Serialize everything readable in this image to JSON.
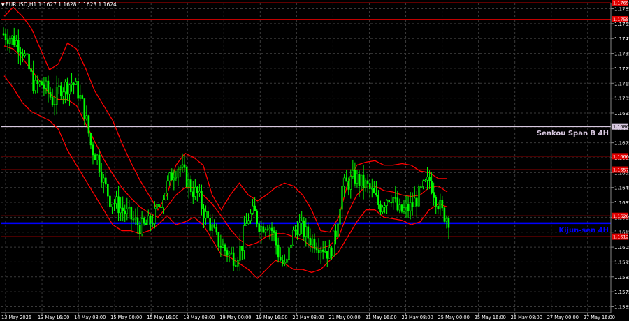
{
  "header": {
    "symbol_info": "EURUSD,H1  1.1627 1.1628 1.1623 1.1624"
  },
  "colors": {
    "background": "#000000",
    "grid": "#3a3a3a",
    "bull": "#00ff00",
    "bear": "#00ff00",
    "bands": "#ff0000",
    "levels": "#c00000",
    "senkou": "#d8c8e0",
    "kijun": "#0000ff",
    "text": "#ffffff"
  },
  "chart_data": {
    "type": "candlestick",
    "title": "",
    "y_ticks": [
      "1.1765",
      "1.1755",
      "1.1745",
      "1.1735",
      "1.1725",
      "1.1715",
      "1.1705",
      "1.1695",
      "1.1685",
      "1.1675",
      "1.1665",
      "1.1655",
      "1.1645",
      "1.1635",
      "1.1625",
      "1.1615",
      "1.1605",
      "1.1595",
      "1.1585",
      "1.1575",
      "1.1565"
    ],
    "ylim": [
      1.1561,
      1.1769
    ],
    "x_ticks": [
      "13 May 2026",
      "13 May 16:00",
      "14 May 08:00",
      "15 May 00:00",
      "15 May 16:00",
      "18 May 08:00",
      "19 May 00:00",
      "19 May 16:00",
      "20 May 08:00",
      "21 May 00:00",
      "21 May 16:00",
      "22 May 08:00",
      "25 May 00:00",
      "25 May 16:00",
      "26 May 08:00",
      "27 May 00:00",
      "27 May 16:00"
    ],
    "horizontal_levels": [
      {
        "value": 1.1769,
        "label": "1.1769",
        "kind": "resistance"
      },
      {
        "value": 1.1758,
        "label": "1.1758",
        "kind": "resistance"
      },
      {
        "value": 1.1666,
        "label": "1.1666",
        "kind": "resistance"
      },
      {
        "value": 1.1657,
        "label": "1.1657",
        "kind": "resistance"
      },
      {
        "value": 1.1686,
        "label": "1.1686",
        "kind": "senkou"
      },
      {
        "value": 1.1626,
        "label": "1.1626",
        "kind": "support"
      },
      {
        "value": 1.1612,
        "label": "1.1612",
        "kind": "support"
      },
      {
        "value": 1.1621,
        "label": "",
        "kind": "kijun"
      }
    ],
    "line_labels": {
      "senkou": "Senkou Span B 4H",
      "kijun": "Kijun-sen 4H"
    },
    "close_path": [
      1.1748,
      1.1746,
      1.1743,
      1.1738,
      1.1725,
      1.1712,
      1.1715,
      1.171,
      1.1702,
      1.1712,
      1.1713,
      1.1716,
      1.1708,
      1.1695,
      1.1672,
      1.1665,
      1.1648,
      1.1637,
      1.1634,
      1.163,
      1.1626,
      1.1622,
      1.1618,
      1.162,
      1.1625,
      1.1635,
      1.1645,
      1.1655,
      1.166,
      1.1652,
      1.1644,
      1.164,
      1.1628,
      1.162,
      1.161,
      1.1605,
      1.16,
      1.1598,
      1.1606,
      1.1625,
      1.1628,
      1.1618,
      1.1622,
      1.1615,
      1.1598,
      1.159,
      1.1612,
      1.162,
      1.1615,
      1.161,
      1.1608,
      1.1605,
      1.16,
      1.1615,
      1.1645,
      1.1648,
      1.1652,
      1.1648,
      1.1646,
      1.164,
      1.1632,
      1.1638,
      1.164,
      1.1628,
      1.163,
      1.1632,
      1.1638,
      1.1645,
      1.165,
      1.1638,
      1.1628,
      1.1624
    ],
    "upper_band": [
      1.176,
      1.1766,
      1.176,
      1.1752,
      1.1738,
      1.1724,
      1.1728,
      1.1742,
      1.1738,
      1.1725,
      1.171,
      1.17,
      1.169,
      1.1675,
      1.1662,
      1.165,
      1.164,
      1.163,
      1.164,
      1.166,
      1.1668,
      1.1665,
      1.166,
      1.164,
      1.163,
      1.164,
      1.1648,
      1.164,
      1.1636,
      1.164,
      1.1645,
      1.1648,
      1.1646,
      1.164,
      1.163,
      1.1616,
      1.1615,
      1.1625,
      1.1648,
      1.166,
      1.1662,
      1.1663,
      1.166,
      1.166,
      1.1661,
      1.166,
      1.1656,
      1.1655,
      1.1651,
      1.1651
    ],
    "middle_band": [
      1.174,
      1.1738,
      1.1732,
      1.1724,
      1.1716,
      1.1708,
      1.1704,
      1.1704,
      1.17,
      1.1688,
      1.1676,
      1.1664,
      1.1654,
      1.1645,
      1.1638,
      1.1632,
      1.1628,
      1.1625,
      1.1632,
      1.164,
      1.1645,
      1.1645,
      1.164,
      1.1634,
      1.1626,
      1.1617,
      1.161,
      1.1606,
      1.1608,
      1.1612,
      1.1614,
      1.1614,
      1.1612,
      1.161,
      1.1605,
      1.1604,
      1.1606,
      1.1612,
      1.1628,
      1.164,
      1.1646,
      1.1646,
      1.1643,
      1.1642,
      1.164,
      1.1639,
      1.164,
      1.1645,
      1.1646,
      1.1642
    ],
    "lower_band": [
      1.172,
      1.1712,
      1.1702,
      1.1696,
      1.1693,
      1.169,
      1.1684,
      1.167,
      1.166,
      1.165,
      1.164,
      1.163,
      1.162,
      1.1616,
      1.1616,
      1.1614,
      1.1616,
      1.162,
      1.1626,
      1.162,
      1.1622,
      1.1625,
      1.162,
      1.161,
      1.16,
      1.1598,
      1.1594,
      1.159,
      1.1584,
      1.159,
      1.1596,
      1.1594,
      1.159,
      1.159,
      1.1588,
      1.159,
      1.1596,
      1.1602,
      1.1612,
      1.1622,
      1.163,
      1.163,
      1.1625,
      1.1624,
      1.1623,
      1.162,
      1.1622,
      1.163,
      1.1634,
      1.1632
    ]
  }
}
